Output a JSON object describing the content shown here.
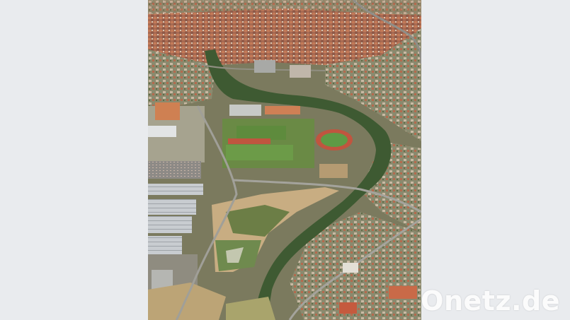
{
  "watermark": {
    "text": "Onetz.de"
  },
  "colors": {
    "background": "#e9ebee",
    "watermark": "#ffffff",
    "roofs": "#b8684a",
    "fields": "#6f8a4e",
    "track": "#c0553f"
  }
}
